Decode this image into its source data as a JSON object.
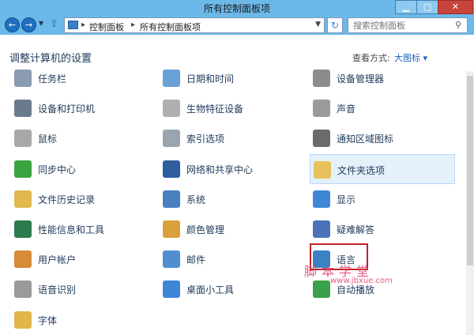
{
  "window": {
    "title": "所有控制面板项",
    "min_glyph": "▁",
    "max_glyph": "□",
    "close_glyph": "✕"
  },
  "nav": {
    "back_glyph": "←",
    "forward_glyph": "→",
    "dropdown_glyph": "▼",
    "up_glyph": "⇧",
    "breadcrumbs": [
      "控制面板",
      "所有控制面板项"
    ],
    "sep_glyph": "▸",
    "refresh_glyph": "↻",
    "search_placeholder": "搜索控制面板",
    "search_glyph": "⚲"
  },
  "heading": {
    "title": "调整计算机的设置",
    "view_label": "查看方式:",
    "view_value": "大图标 ▾"
  },
  "items": [
    {
      "label": "任务栏",
      "icon": "taskbar-icon",
      "color": "#8a9bb0"
    },
    {
      "label": "日期和时间",
      "icon": "calendar-clock-icon",
      "color": "#6aa0d8"
    },
    {
      "label": "设备管理器",
      "icon": "device-manager-icon",
      "color": "#8c8c8c"
    },
    {
      "label": "设备和打印机",
      "icon": "printer-icon",
      "color": "#6b7b8f"
    },
    {
      "label": "生物特征设备",
      "icon": "fingerprint-icon",
      "color": "#b0b0b0"
    },
    {
      "label": "声音",
      "icon": "speaker-icon",
      "color": "#9a9a9a"
    },
    {
      "label": "鼠标",
      "icon": "mouse-icon",
      "color": "#a8a8a8"
    },
    {
      "label": "索引选项",
      "icon": "index-magnifier-icon",
      "color": "#9aa5b0"
    },
    {
      "label": "通知区域图标",
      "icon": "notification-tray-icon",
      "color": "#6b6b6b"
    },
    {
      "label": "同步中心",
      "icon": "sync-icon",
      "color": "#3ba341"
    },
    {
      "label": "网络和共享中心",
      "icon": "network-icon",
      "color": "#2f5f9e"
    },
    {
      "label": "文件夹选项",
      "icon": "folder-options-icon",
      "color": "#e8c15a"
    },
    {
      "label": "文件历史记录",
      "icon": "file-history-icon",
      "color": "#e0b84e"
    },
    {
      "label": "系统",
      "icon": "system-icon",
      "color": "#4a7fc0"
    },
    {
      "label": "显示",
      "icon": "display-icon",
      "color": "#3f86d6"
    },
    {
      "label": "性能信息和工具",
      "icon": "performance-icon",
      "color": "#2d7a4f"
    },
    {
      "label": "颜色管理",
      "icon": "color-management-icon",
      "color": "#d9a03c"
    },
    {
      "label": "疑难解答",
      "icon": "troubleshoot-icon",
      "color": "#4a73b8"
    },
    {
      "label": "用户帐户",
      "icon": "user-accounts-icon",
      "color": "#d78a3a"
    },
    {
      "label": "邮件",
      "icon": "mail-icon",
      "color": "#4f8fd0"
    },
    {
      "label": "语言",
      "icon": "language-icon",
      "color": "#3b82c4"
    },
    {
      "label": "语音识别",
      "icon": "microphone-icon",
      "color": "#9a9a9a"
    },
    {
      "label": "桌面小工具",
      "icon": "gadgets-icon",
      "color": "#3f86d6"
    },
    {
      "label": "自动播放",
      "icon": "autoplay-icon",
      "color": "#3aa04a"
    },
    {
      "label": "字体",
      "icon": "fonts-icon",
      "color": "#e2b548"
    }
  ],
  "selected_label": "文件夹选项",
  "watermark": {
    "text": "脚本学堂",
    "url": "www.jbxue.com"
  }
}
